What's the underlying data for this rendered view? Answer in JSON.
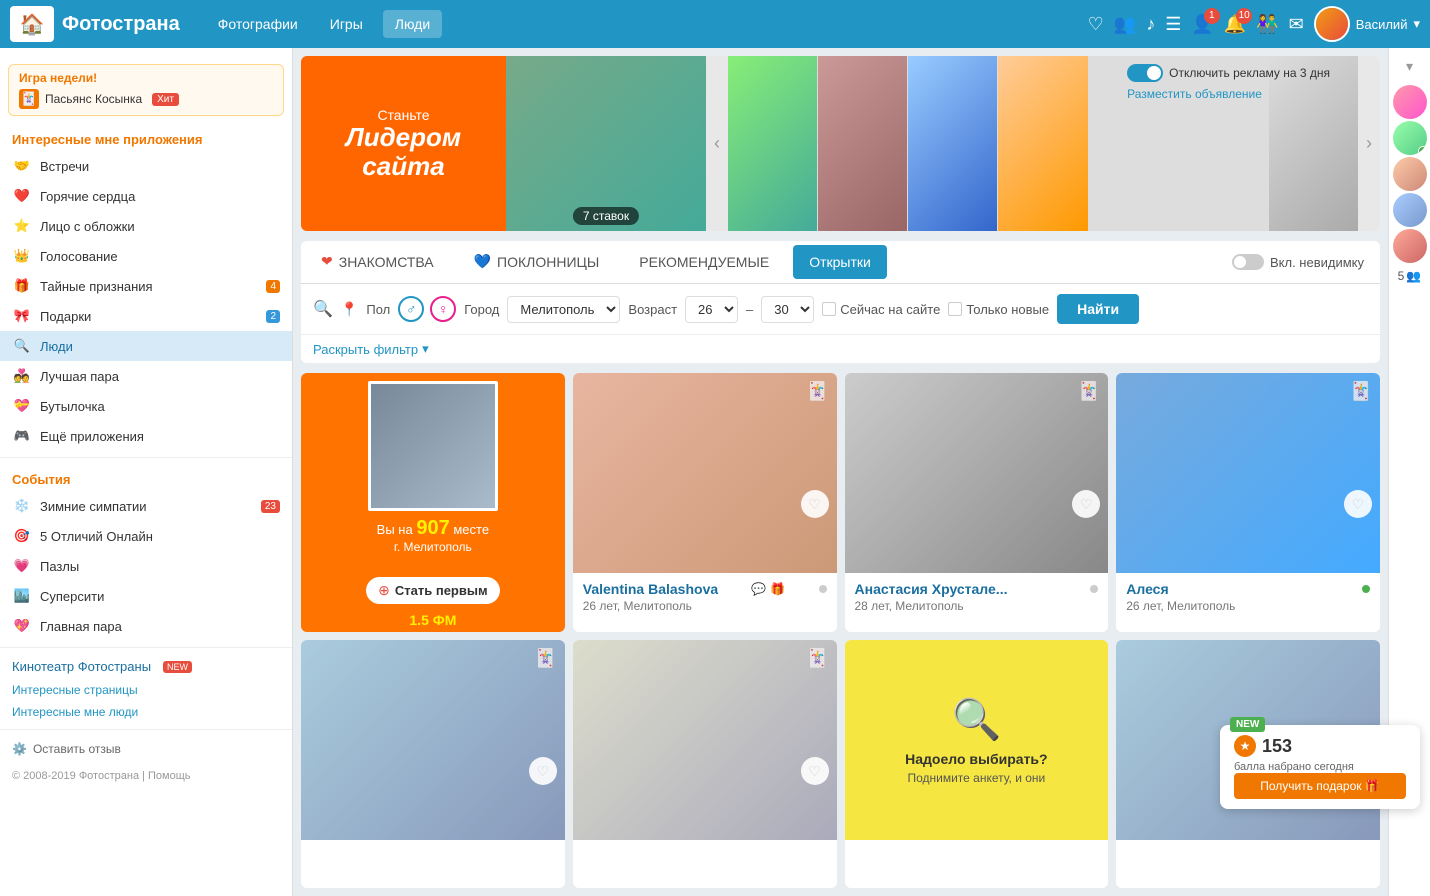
{
  "header": {
    "logo": "Фотострана",
    "nav": [
      {
        "label": "Фотографии",
        "active": false
      },
      {
        "label": "Игры",
        "active": false
      },
      {
        "label": "Люди",
        "active": true
      }
    ],
    "user": "Василий",
    "badge1": "1",
    "badge2": "10"
  },
  "sidebar": {
    "game_week_title": "Игра недели!",
    "game_name": "Пасьянс Косынка",
    "game_hit": "Хит",
    "interesting_apps": "Интересные мне приложения",
    "meetings": "Встречи",
    "items": [
      {
        "label": "Горячие сердца",
        "icon": "❤️",
        "badge": null
      },
      {
        "label": "Лицо с обложки",
        "icon": "⭐",
        "badge": null
      },
      {
        "label": "Голосование",
        "icon": "👑",
        "badge": null
      },
      {
        "label": "Тайные признания",
        "icon": "🎁",
        "badge": "4"
      },
      {
        "label": "Подарки",
        "icon": "🎀",
        "badge": "2"
      },
      {
        "label": "Люди",
        "icon": "🔍",
        "badge": null,
        "active": true
      },
      {
        "label": "Лучшая пара",
        "icon": "💑",
        "badge": null
      },
      {
        "label": "Бутылочка",
        "icon": "💝",
        "badge": null
      },
      {
        "label": "Ещё приложения",
        "icon": "🎮",
        "badge": null
      }
    ],
    "events_title": "События",
    "events": [
      {
        "label": "Зимние симпатии",
        "icon": "❄️",
        "badge": "23"
      },
      {
        "label": "5 Отличий Онлайн",
        "icon": "🎯",
        "badge": null
      },
      {
        "label": "Пазлы",
        "icon": "💗",
        "badge": null
      },
      {
        "label": "Суперсити",
        "icon": "🏙️",
        "badge": null
      },
      {
        "label": "Главная пара",
        "icon": "💖",
        "badge": null
      }
    ],
    "kinotheater": "Кинотеатр Фотостраны",
    "kinotheater_badge": "NEW",
    "interesting_pages": "Интересные страницы",
    "interesting_people": "Интересные мне люди",
    "feedback": "Оставить отзыв",
    "copyright": "© 2008-2019 Фотострана | Помощь"
  },
  "banner": {
    "title": "Станьте",
    "name_line1": "Лидером",
    "name_line2": "сайта",
    "bids": "7 ставок",
    "nav_left": "‹",
    "nav_right": "›"
  },
  "ad": {
    "toggle_label": "Отключить рекламу на 3 дня",
    "place_ad": "Разместить объявление"
  },
  "search": {
    "tabs": [
      {
        "label": "ЗНАКОМСТВА",
        "icon": "❤️",
        "active": false
      },
      {
        "label": "ПОКЛОННИЦЫ",
        "icon": "💙",
        "active": false
      },
      {
        "label": "РЕКОМЕНДУЕМЫЕ",
        "active": false
      },
      {
        "label": "Открытки",
        "active": true
      }
    ],
    "invisible_label": "Вкл. невидимку",
    "gender_label": "Пол",
    "city_label": "Город",
    "city_value": "Мелитополь",
    "age_label": "Возраст",
    "age_from": "26",
    "age_to": "30",
    "online_label": "Сейчас на сайте",
    "new_label": "Только новые",
    "find_btn": "Найти",
    "expand_label": "Раскрыть фильтр"
  },
  "profiles": [
    {
      "type": "rank",
      "rank": "907",
      "city": "г. Мелитополь",
      "rank_prefix": "Вы на",
      "rank_suffix": "месте",
      "become_first": "Стать первым",
      "fm": "1.5 ФМ"
    },
    {
      "name": "Valentina Balashova",
      "age": "26 лет, Мелитополь",
      "online": false,
      "photo_class": "photo-bg-1"
    },
    {
      "name": "Анастасия Хрустале...",
      "age": "28 лет, Мелитополь",
      "online": false,
      "photo_class": "photo-bg-2"
    },
    {
      "name": "Алеся",
      "age": "26 лет, Мелитополь",
      "online": true,
      "photo_class": "photo-bg-3"
    },
    {
      "name": "",
      "age": "",
      "online": false,
      "photo_class": "photo-bg-4"
    },
    {
      "name": "",
      "age": "",
      "online": false,
      "photo_class": "photo-bg-5"
    },
    {
      "type": "suggest",
      "text": "Надоело выбирать?",
      "subtext": "Поднимите анкету, и они",
      "photo_class": "photo-bg-6"
    },
    {
      "name": "",
      "age": "",
      "online": false,
      "photo_class": "photo-bg-4"
    }
  ],
  "points": {
    "new_label": "NEW",
    "amount": "153",
    "description": "балла набрано сегодня",
    "button": "Получить подарок 🎁"
  }
}
